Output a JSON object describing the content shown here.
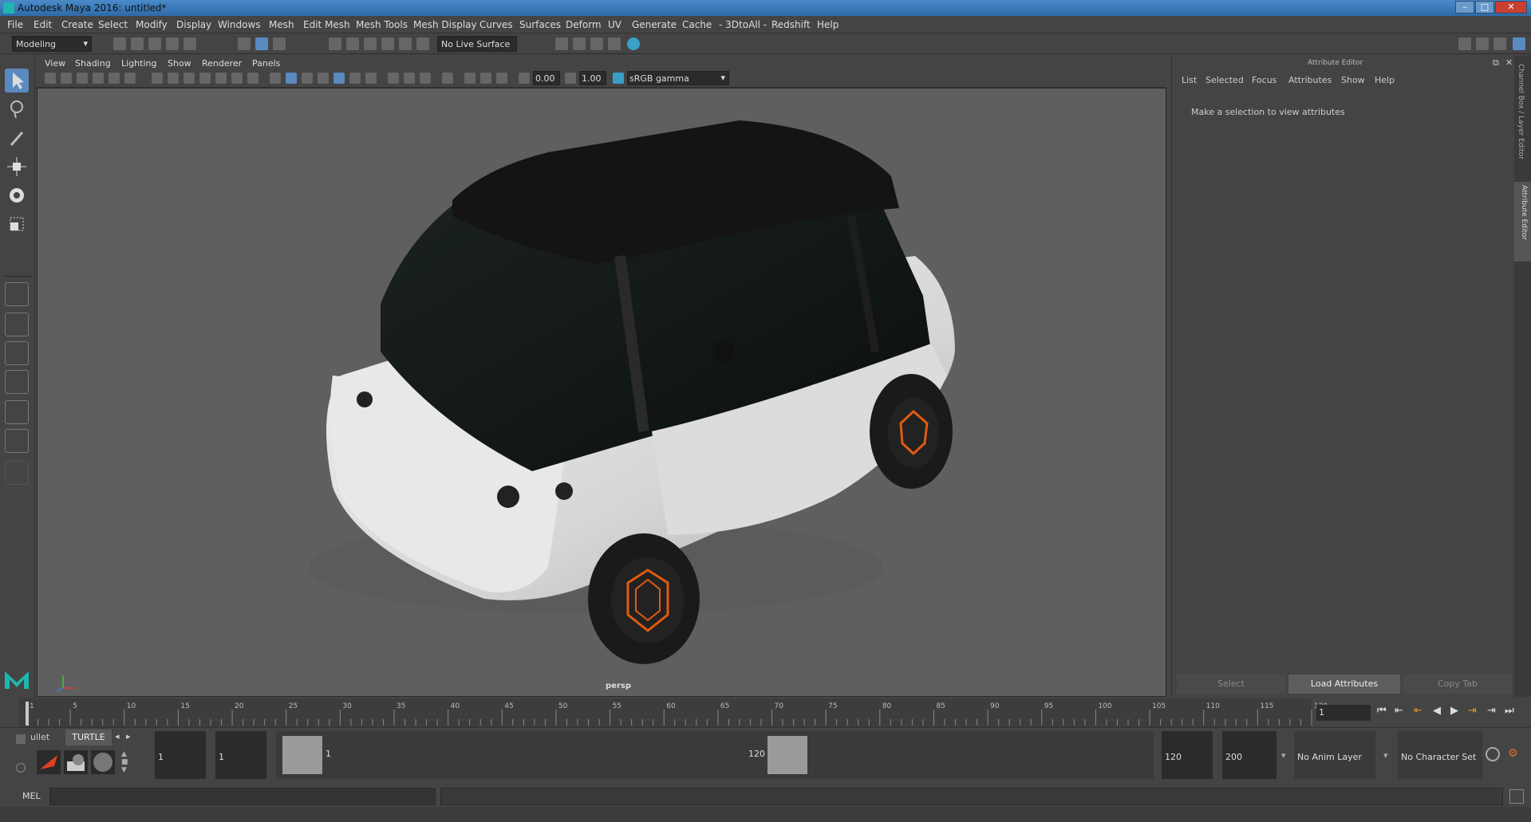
{
  "window": {
    "title": "Autodesk Maya 2016: untitled*"
  },
  "menu": [
    "File",
    "Edit",
    "Create",
    "Select",
    "Modify",
    "Display",
    "Windows",
    "Mesh",
    "Edit Mesh",
    "Mesh Tools",
    "Mesh Display",
    "Curves",
    "Surfaces",
    "Deform",
    "UV",
    "Generate",
    "Cache",
    "- 3DtoAll -",
    "Redshift",
    "Help"
  ],
  "shelf": {
    "mode": "Modeling",
    "live_surface": "No Live Surface"
  },
  "viewport": {
    "menu": [
      "View",
      "Shading",
      "Lighting",
      "Show",
      "Renderer",
      "Panels"
    ],
    "value_a": "0.00",
    "value_b": "1.00",
    "colorspace": "sRGB gamma",
    "camera": "persp"
  },
  "attribute_editor": {
    "title": "Attribute Editor",
    "menu": [
      "List",
      "Selected",
      "Focus",
      "Attributes",
      "Show",
      "Help"
    ],
    "message": "Make a selection to view attributes",
    "buttons": [
      "Select",
      "Load Attributes",
      "Copy Tab"
    ],
    "side_tabs": [
      "Channel Box / Layer Editor",
      "Attribute Editor"
    ]
  },
  "timeline": {
    "ticks": [
      "1",
      "5",
      "10",
      "15",
      "20",
      "25",
      "30",
      "35",
      "40",
      "45",
      "50",
      "55",
      "60",
      "65",
      "70",
      "75",
      "80",
      "85",
      "90",
      "95",
      "100",
      "105",
      "110",
      "115",
      "120"
    ],
    "current_frame": "1"
  },
  "range": {
    "shelf_tabs": [
      "ullet",
      "TURTLE"
    ],
    "start": "1",
    "start2": "1",
    "slider_start": "1",
    "slider_end": "120",
    "end": "120",
    "end2": "200",
    "anim_layer": "No Anim Layer",
    "char_set": "No Character Set"
  },
  "mel": {
    "label": "MEL"
  },
  "colors": {
    "accent": "#1fb6b0",
    "car_body": "#e8e8e8",
    "wheel_accent": "#e05a10"
  }
}
